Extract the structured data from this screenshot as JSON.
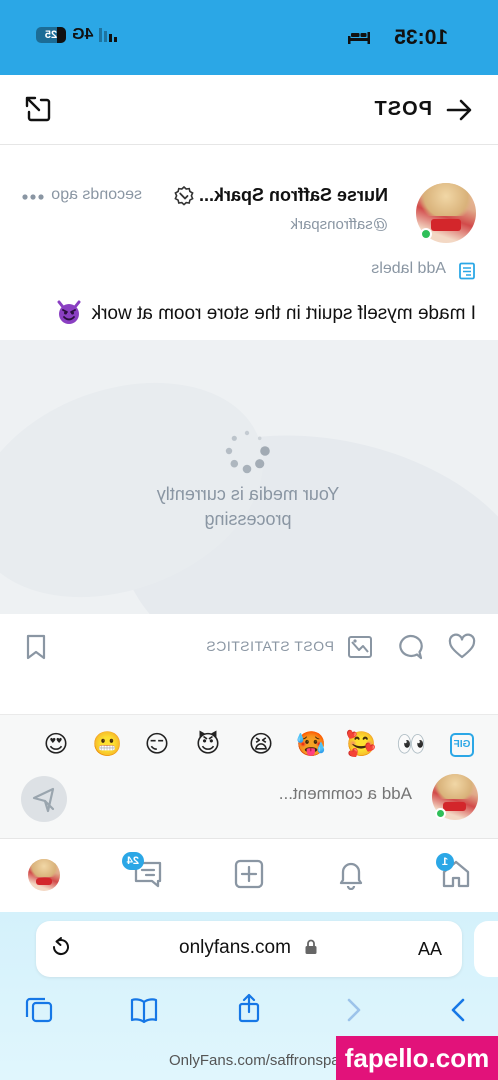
{
  "status_bar": {
    "time": "10:35",
    "network": "4G",
    "battery": "25"
  },
  "header": {
    "title": "POST"
  },
  "post": {
    "author_name": "Nurse Saffron Spark...",
    "time_ago": "seconds ago",
    "handle": "@saffronspark",
    "add_labels": "Add labels",
    "text": "I made myself squirt in the store room at work",
    "text_emoji": "smiling-devil",
    "processing_line1": "Your media is currently",
    "processing_line2": "processing",
    "stats_label": "POST STATISTICS"
  },
  "comment": {
    "gif_label": "GIF",
    "emojis": [
      "👀",
      "🥰",
      "🥵",
      "😫",
      "😈",
      "😏",
      "😬",
      "😍"
    ],
    "placeholder": "Add a comment..."
  },
  "bottom_nav": {
    "home_badge": "1",
    "messages_badge": "24"
  },
  "browser": {
    "aa_label": "AA",
    "url": "onlyfans.com",
    "status_url": "OnlyFans.com/saffronsparkfree"
  },
  "watermark": "fapello.com",
  "colors": {
    "accent": "#2ba7e6",
    "online": "#2fbf59",
    "muted": "#8a96a3",
    "watermark": "#e2127a"
  }
}
